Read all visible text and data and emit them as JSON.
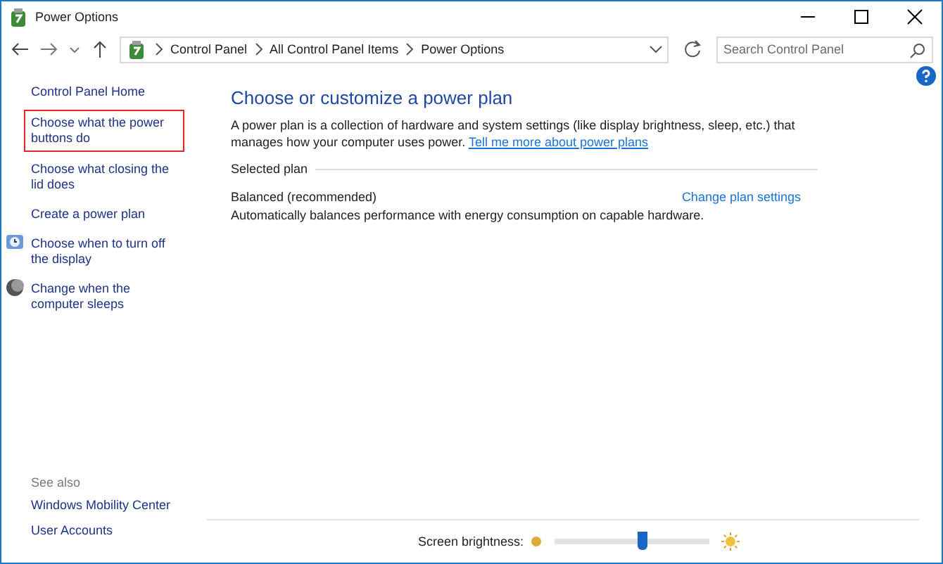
{
  "window": {
    "title": "Power Options"
  },
  "address_bar": {
    "crumbs": [
      "Control Panel",
      "All Control Panel Items",
      "Power Options"
    ]
  },
  "search": {
    "placeholder": "Search Control Panel"
  },
  "sidebar": {
    "home": "Control Panel Home",
    "items": [
      {
        "label": "Choose what the power buttons do",
        "kind": "plain",
        "highlighted": true
      },
      {
        "label": "Choose what closing the lid does",
        "kind": "plain",
        "highlighted": false
      },
      {
        "label": "Create a power plan",
        "kind": "plain",
        "highlighted": false
      },
      {
        "label": "Choose when to turn off the display",
        "kind": "screen",
        "highlighted": false
      },
      {
        "label": "Change when the computer sleeps",
        "kind": "sleep",
        "highlighted": false
      }
    ],
    "see_also": {
      "heading": "See also",
      "links": [
        "Windows Mobility Center",
        "User Accounts"
      ]
    }
  },
  "main": {
    "title": "Choose or customize a power plan",
    "description": "A power plan is a collection of hardware and system settings (like display brightness, sleep, etc.) that manages how your computer uses power.",
    "more_link": "Tell me more about power plans",
    "section": "Selected plan",
    "plan": {
      "name": "Balanced (recommended)",
      "settings_link": "Change plan settings",
      "description": "Automatically balances performance with energy consumption on capable hardware."
    }
  },
  "brightness": {
    "label": "Screen brightness:",
    "level": 0.56
  }
}
